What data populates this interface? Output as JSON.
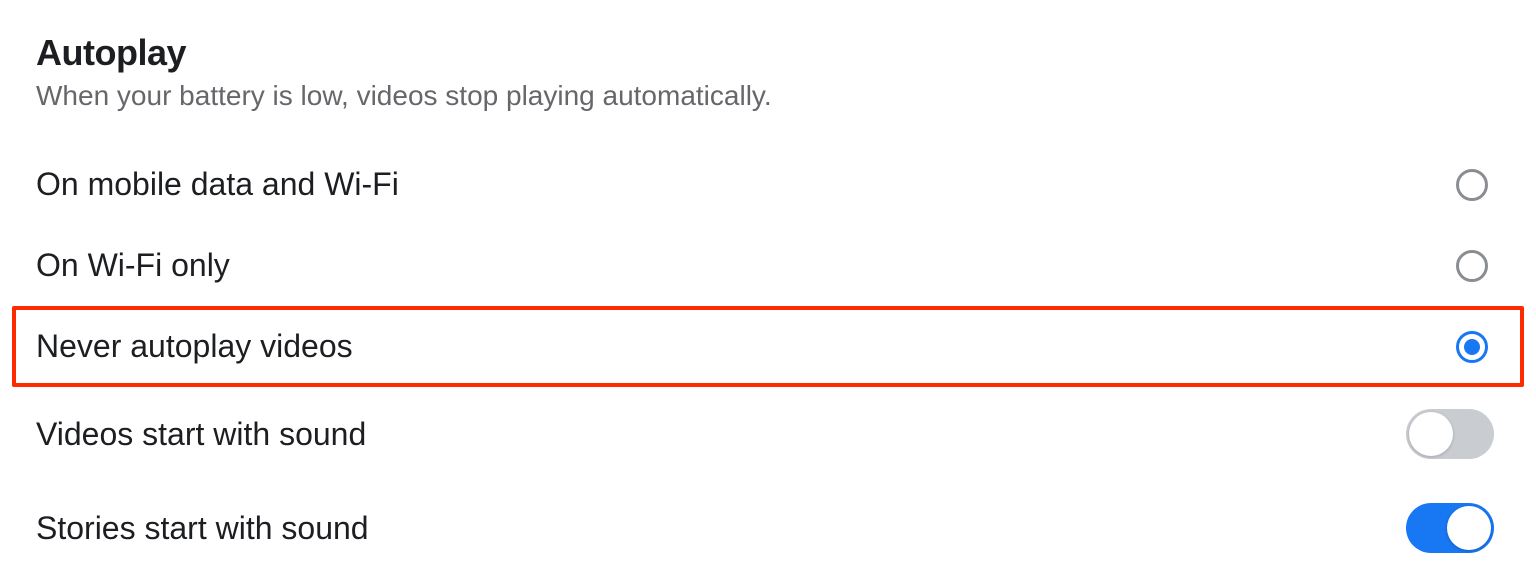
{
  "section": {
    "title": "Autoplay",
    "subtitle": "When your battery is low, videos stop playing automatically."
  },
  "options": {
    "mobile_wifi": "On mobile data and Wi-Fi",
    "wifi_only": "On Wi-Fi only",
    "never": "Never autoplay videos",
    "selected": "never"
  },
  "toggles": {
    "videos_sound": {
      "label": "Videos start with sound",
      "value": false
    },
    "stories_sound": {
      "label": "Stories start with sound",
      "value": true
    }
  },
  "colors": {
    "accent": "#1877f2",
    "highlight_border": "#ff2a00",
    "text_primary": "#1c1e21",
    "text_secondary": "#65676b",
    "toggle_off": "#c9ccd1",
    "radio_border": "#8a8d91"
  }
}
